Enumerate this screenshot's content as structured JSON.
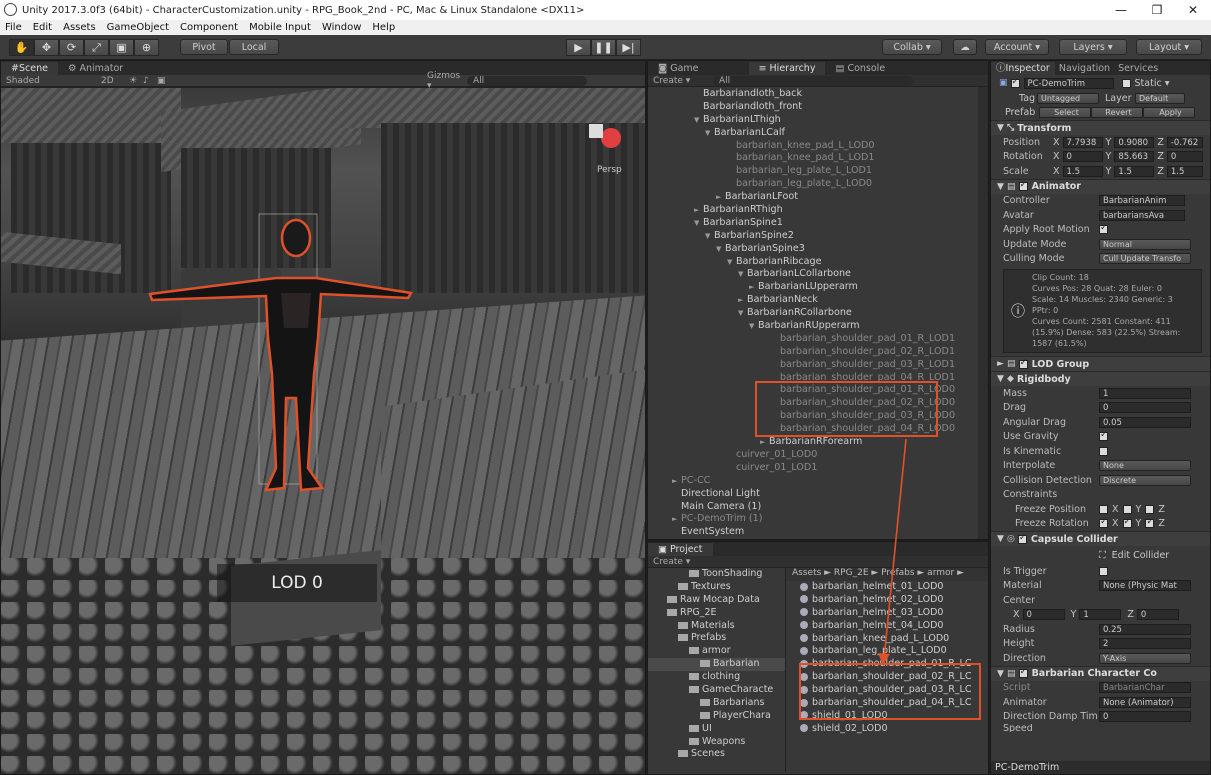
{
  "window": {
    "title": "Unity 2017.3.0f3 (64bit) - CharacterCustomization.unity - RPG_Book_2nd - PC, Mac & Linux Standalone <DX11>"
  },
  "menu": [
    "File",
    "Edit",
    "Assets",
    "GameObject",
    "Component",
    "Mobile Input",
    "Window",
    "Help"
  ],
  "toolbar": {
    "pivot": "Pivot",
    "local": "Local",
    "collab": "Collab ▾",
    "account": "Account ▾",
    "layers": "Layers ▾",
    "layout": "Layout ▾"
  },
  "scene": {
    "tab_scene": "Scene",
    "tab_animator": "Animator",
    "shaded": "Shaded",
    "mode2d": "2D",
    "gizmos": "Gizmos ▾",
    "search": "All",
    "persp": "Persp",
    "lod_label": "LOD 0"
  },
  "hierarchy": {
    "tab_game": "Game",
    "tab_hier": "Hierarchy",
    "tab_console": "Console",
    "create": "Create ▾",
    "search": "All",
    "items": [
      {
        "t": "Barbariandloth_back",
        "i": 0,
        "a": ""
      },
      {
        "t": "Barbariandloth_front",
        "i": 0,
        "a": ""
      },
      {
        "t": "BarbarianLThigh",
        "i": 0,
        "a": "▼"
      },
      {
        "t": "BarbarianLCalf",
        "i": 1,
        "a": "▼"
      },
      {
        "t": "barbarian_knee_pad_L_LOD0",
        "i": 3,
        "a": "",
        "d": true
      },
      {
        "t": "barbarian_knee_pad_L_LOD1",
        "i": 3,
        "a": "",
        "d": true
      },
      {
        "t": "barbarian_leg_plate_L_LOD1",
        "i": 3,
        "a": "",
        "d": true
      },
      {
        "t": "barbarian_leg_plate_L_LOD0",
        "i": 3,
        "a": "",
        "d": true
      },
      {
        "t": "BarbarianLFoot",
        "i": 2,
        "a": "►"
      },
      {
        "t": "BarbarianRThigh",
        "i": 0,
        "a": "►"
      },
      {
        "t": "BarbarianSpine1",
        "i": 0,
        "a": "▼"
      },
      {
        "t": "BarbarianSpine2",
        "i": 1,
        "a": "▼"
      },
      {
        "t": "BarbarianSpine3",
        "i": 2,
        "a": "▼"
      },
      {
        "t": "BarbarianRibcage",
        "i": 3,
        "a": "▼"
      },
      {
        "t": "BarbarianLCollarbone",
        "i": 4,
        "a": "▼"
      },
      {
        "t": "BarbarianLUpperarm",
        "i": 5,
        "a": "►"
      },
      {
        "t": "BarbarianNeck",
        "i": 4,
        "a": "►"
      },
      {
        "t": "BarbarianRCollarbone",
        "i": 4,
        "a": "▼"
      },
      {
        "t": "BarbarianRUpperarm",
        "i": 5,
        "a": "▼"
      },
      {
        "t": "barbarian_shoulder_pad_01_R_LOD1",
        "i": 7,
        "a": "",
        "d": true
      },
      {
        "t": "barbarian_shoulder_pad_02_R_LOD1",
        "i": 7,
        "a": "",
        "d": true
      },
      {
        "t": "barbarian_shoulder_pad_03_R_LOD1",
        "i": 7,
        "a": "",
        "d": true
      },
      {
        "t": "barbarian_shoulder_pad_04_R_LOD1",
        "i": 7,
        "a": "",
        "d": true
      },
      {
        "t": "barbarian_shoulder_pad_01_R_LOD0",
        "i": 7,
        "a": "",
        "d": true
      },
      {
        "t": "barbarian_shoulder_pad_02_R_LOD0",
        "i": 7,
        "a": "",
        "d": true
      },
      {
        "t": "barbarian_shoulder_pad_03_R_LOD0",
        "i": 7,
        "a": "",
        "d": true
      },
      {
        "t": "barbarian_shoulder_pad_04_R_LOD0",
        "i": 7,
        "a": "",
        "d": true
      },
      {
        "t": "BarbarianRForearm",
        "i": 6,
        "a": "►"
      },
      {
        "t": "cuirver_01_LOD0",
        "i": 3,
        "a": "",
        "d": true
      },
      {
        "t": "cuirver_01_LOD1",
        "i": 3,
        "a": "",
        "d": true
      },
      {
        "t": "PC-CC",
        "i": -2,
        "a": "►",
        "d": true
      },
      {
        "t": "Directional Light",
        "i": -2,
        "a": ""
      },
      {
        "t": "Main Camera (1)",
        "i": -2,
        "a": ""
      },
      {
        "t": "PC-DemoTrim (1)",
        "i": -2,
        "a": "►",
        "d": true
      },
      {
        "t": "EventSystem",
        "i": -2,
        "a": ""
      }
    ]
  },
  "project": {
    "tab": "Project",
    "create": "Create ▾",
    "breadcrumb": "Assets ► RPG_2E ► Prefabs ► armor ►",
    "folders": [
      {
        "t": "ToonShading",
        "i": 3
      },
      {
        "t": "Textures",
        "i": 2
      },
      {
        "t": "Raw Mocap Data",
        "i": 1
      },
      {
        "t": "RPG_2E",
        "i": 1
      },
      {
        "t": "Materials",
        "i": 2
      },
      {
        "t": "Prefabs",
        "i": 2
      },
      {
        "t": "armor",
        "i": 3
      },
      {
        "t": "Barbarian",
        "i": 4
      },
      {
        "t": "clothing",
        "i": 3
      },
      {
        "t": "GameCharacte",
        "i": 3
      },
      {
        "t": "Barbarians",
        "i": 4
      },
      {
        "t": "PlayerChara",
        "i": 4
      },
      {
        "t": "UI",
        "i": 3
      },
      {
        "t": "Weapons",
        "i": 3
      },
      {
        "t": "Scenes",
        "i": 2
      }
    ],
    "assets": [
      "barbarian_helmet_01_LOD0",
      "barbarian_helmet_02_LOD0",
      "barbarian_helmet_03_LOD0",
      "barbarian_helmet_04_LOD0",
      "barbarian_knee_pad_L_LOD0",
      "barbarian_leg_plate_L_LOD0",
      "barbarian_shoulder_pad_01_R_LC",
      "barbarian_shoulder_pad_02_R_LC",
      "barbarian_shoulder_pad_03_R_LC",
      "barbarian_shoulder_pad_04_R_LC",
      "shield_01_LOD0",
      "shield_02_LOD0"
    ]
  },
  "inspector": {
    "tab_insp": "Inspector",
    "tab_nav": "Navigation",
    "tab_serv": "Services",
    "name": "PC-DemoTrim",
    "static": "Static ▾",
    "tag_lbl": "Tag",
    "tag": "Untagged",
    "layer_lbl": "Layer",
    "layer": "Default",
    "prefab_lbl": "Prefab",
    "select": "Select",
    "revert": "Revert",
    "apply": "Apply",
    "transform": {
      "title": "Transform",
      "pos_lbl": "Position",
      "px": "7.7938",
      "py": "0.9080",
      "pz": "-0.762",
      "rot_lbl": "Rotation",
      "rx": "0",
      "ry": "85.663",
      "rz": "0",
      "scale_lbl": "Scale",
      "sx": "1.5",
      "sy": "1.5",
      "sz": "1.5"
    },
    "animator": {
      "title": "Animator",
      "ctrl_lbl": "Controller",
      "ctrl": "BarbarianAnim",
      "avatar_lbl": "Avatar",
      "avatar": "barbariansAva",
      "root_lbl": "Apply Root Motion",
      "upd_lbl": "Update Mode",
      "upd": "Normal",
      "cull_lbl": "Culling Mode",
      "cull": "Cull Update Transfo",
      "info": [
        "Clip Count: 18",
        "Curves Pos: 28 Quat: 28 Euler: 0",
        "Scale: 14 Muscles: 2340 Generic: 3",
        "PPtr: 0",
        "Curves Count: 2581 Constant: 411",
        "(15.9%) Dense: 583 (22.5%) Stream:",
        "1587 (61.5%)"
      ]
    },
    "lod": {
      "title": "LOD Group"
    },
    "rigidbody": {
      "title": "Rigidbody",
      "mass_lbl": "Mass",
      "mass": "1",
      "drag_lbl": "Drag",
      "drag": "0",
      "adrag_lbl": "Angular Drag",
      "adrag": "0.05",
      "grav_lbl": "Use Gravity",
      "kin_lbl": "Is Kinematic",
      "interp_lbl": "Interpolate",
      "interp": "None",
      "coll_lbl": "Collision Detection",
      "coll": "Discrete",
      "cons_lbl": "Constraints",
      "fpos_lbl": "Freeze Position",
      "frot_lbl": "Freeze Rotation",
      "x": "X",
      "y": "Y",
      "z": "Z"
    },
    "capsule": {
      "title": "Capsule Collider",
      "edit": "Edit Collider",
      "trig_lbl": "Is Trigger",
      "mat_lbl": "Material",
      "mat": "None (Physic Mat",
      "center_lbl": "Center",
      "cx": "0",
      "cy": "1",
      "cz": "0",
      "rad_lbl": "Radius",
      "rad": "0.25",
      "h_lbl": "Height",
      "h": "2",
      "dir_lbl": "Direction",
      "dir": "Y-Axis"
    },
    "script": {
      "title": "Barbarian Character Co",
      "script_lbl": "Script",
      "script": "BarbarianChar",
      "anim_lbl": "Animator",
      "anim": "None (Animator)",
      "damp_lbl": "Direction Damp Tim",
      "damp": "0",
      "speed_lbl": "Speed"
    },
    "footer": "PC-DemoTrim"
  }
}
